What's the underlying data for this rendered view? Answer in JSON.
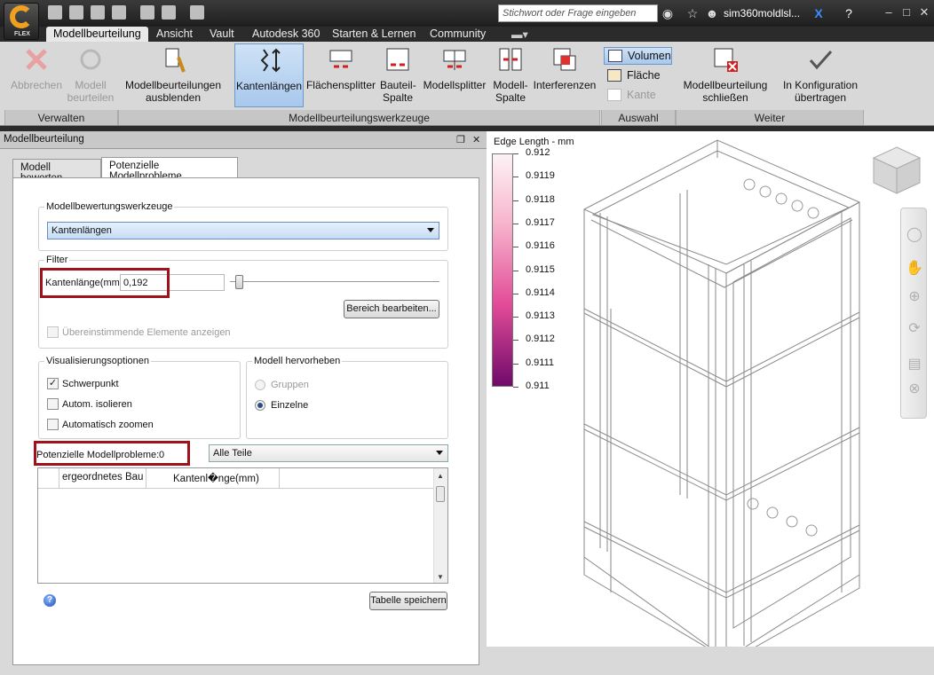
{
  "app": {
    "badge": "FLEX"
  },
  "search": {
    "placeholder": "Stichwort oder Frage eingeben"
  },
  "user": {
    "name": "sim360moldlsl..."
  },
  "tabs": [
    "Modellbeurteilung",
    "Ansicht",
    "Vault",
    "Autodesk 360",
    "Starten & Lernen",
    "Community"
  ],
  "ribbon": {
    "abbrechen": "Abbrechen",
    "modell_beurteilen": [
      "Modell",
      "beurteilen"
    ],
    "ausblenden": [
      "Modellbeurteilungen",
      "ausblenden"
    ],
    "kantenlaengen": "Kantenlängen",
    "flaechensplitter": "Flächensplitter",
    "bauteil_spalte": [
      "Bauteil-",
      "Spalte"
    ],
    "modellsplitter": "Modellsplitter",
    "modell_spalte": [
      "Modell-",
      "Spalte"
    ],
    "interferenzen": "Interferenzen",
    "volumen": "Volumen",
    "flaeche": "Fläche",
    "kante": "Kante",
    "schliessen": [
      "Modellbeurteilung",
      "schließen"
    ],
    "konfiguration": [
      "In Konfiguration",
      "übertragen"
    ],
    "groups": {
      "verwalten": "Verwalten",
      "werkzeuge": "Modellbeurteilungswerkzeuge",
      "auswahl": "Auswahl",
      "weiter": "Weiter"
    }
  },
  "panel": {
    "title": "Modellbeurteilung",
    "tab1": "Modell bewerten",
    "tab2": "Potenzielle Modellprobleme",
    "tools_legend": "Modellbewertungswerkzeuge",
    "tool_selected": "Kantenlängen",
    "filter_legend": "Filter",
    "filter_label": "Kantenlänge(mm)",
    "filter_value": "0,192",
    "range_button": "Bereich bearbeiten...",
    "matching_label": "Übereinstimmende Elemente anzeigen",
    "vis_legend": "Visualisierungsoptionen",
    "vis_options": [
      "Schwerpunkt",
      "Autom. isolieren",
      "Automatisch zoomen"
    ],
    "vis_checked": [
      true,
      false,
      false
    ],
    "highlight_legend": "Modell hervorheben",
    "highlight_options": [
      "Gruppen",
      "Einzelne"
    ],
    "problems_label": "Potenzielle Modellprobleme:",
    "problems_count": "0",
    "parts_filter": "Alle Teile",
    "columns": [
      "ergeordnetes Bau",
      "Kantenl�nge(mm)"
    ],
    "save_table": "Tabelle speichern"
  },
  "viewport": {
    "legend_title": "Edge Length - mm",
    "scale": [
      "0.912",
      "0.9119",
      "0.9118",
      "0.9117",
      "0.9116",
      "0.9115",
      "0.9114",
      "0.9113",
      "0.9112",
      "0.9111",
      "0.911"
    ],
    "colors": {
      "top": "#fdf2f5",
      "mid": "#e24b97",
      "bottom": "#6f0a6a"
    }
  }
}
